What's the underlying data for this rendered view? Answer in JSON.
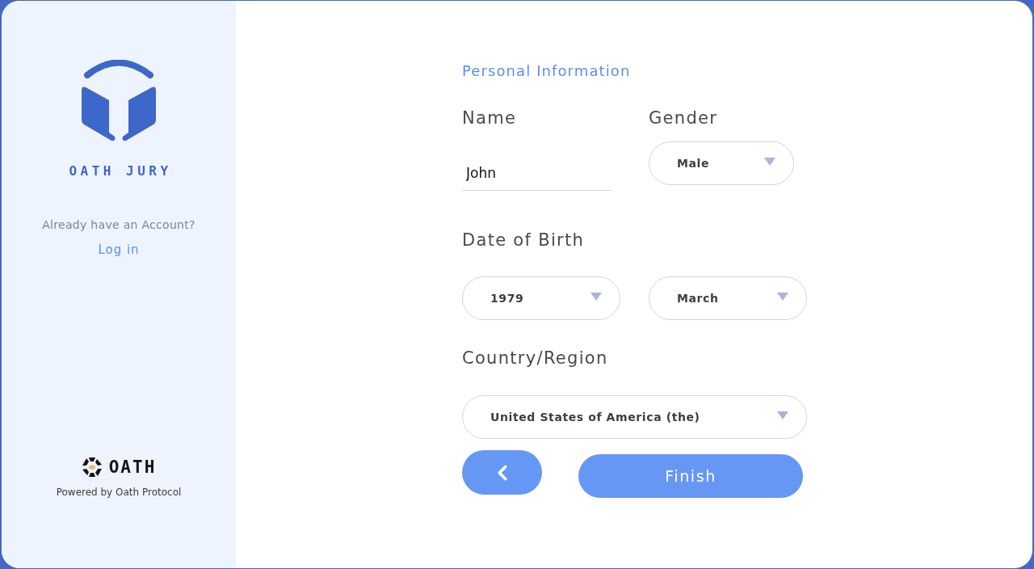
{
  "sidebar": {
    "brand": "OATH JURY",
    "login_prompt": "Already have an Account?",
    "login_link": "Log in",
    "footer_brand": "OATH",
    "footer_caption": "Powered by Oath Protocol"
  },
  "form": {
    "title": "Personal Information",
    "groups": [
      {
        "kind": "text",
        "label": "Name",
        "value": "John"
      },
      {
        "kind": "select",
        "label": "Gender",
        "value": "Male"
      },
      {
        "kind": "pair",
        "label": "Date of Birth",
        "values": [
          "1979",
          "March"
        ]
      },
      {
        "kind": "wide",
        "label": "Country/Region",
        "value": "United States of America (the)"
      }
    ],
    "buttons": [
      {
        "kind": "back"
      },
      {
        "kind": "primary",
        "label": "Finish"
      }
    ]
  }
}
